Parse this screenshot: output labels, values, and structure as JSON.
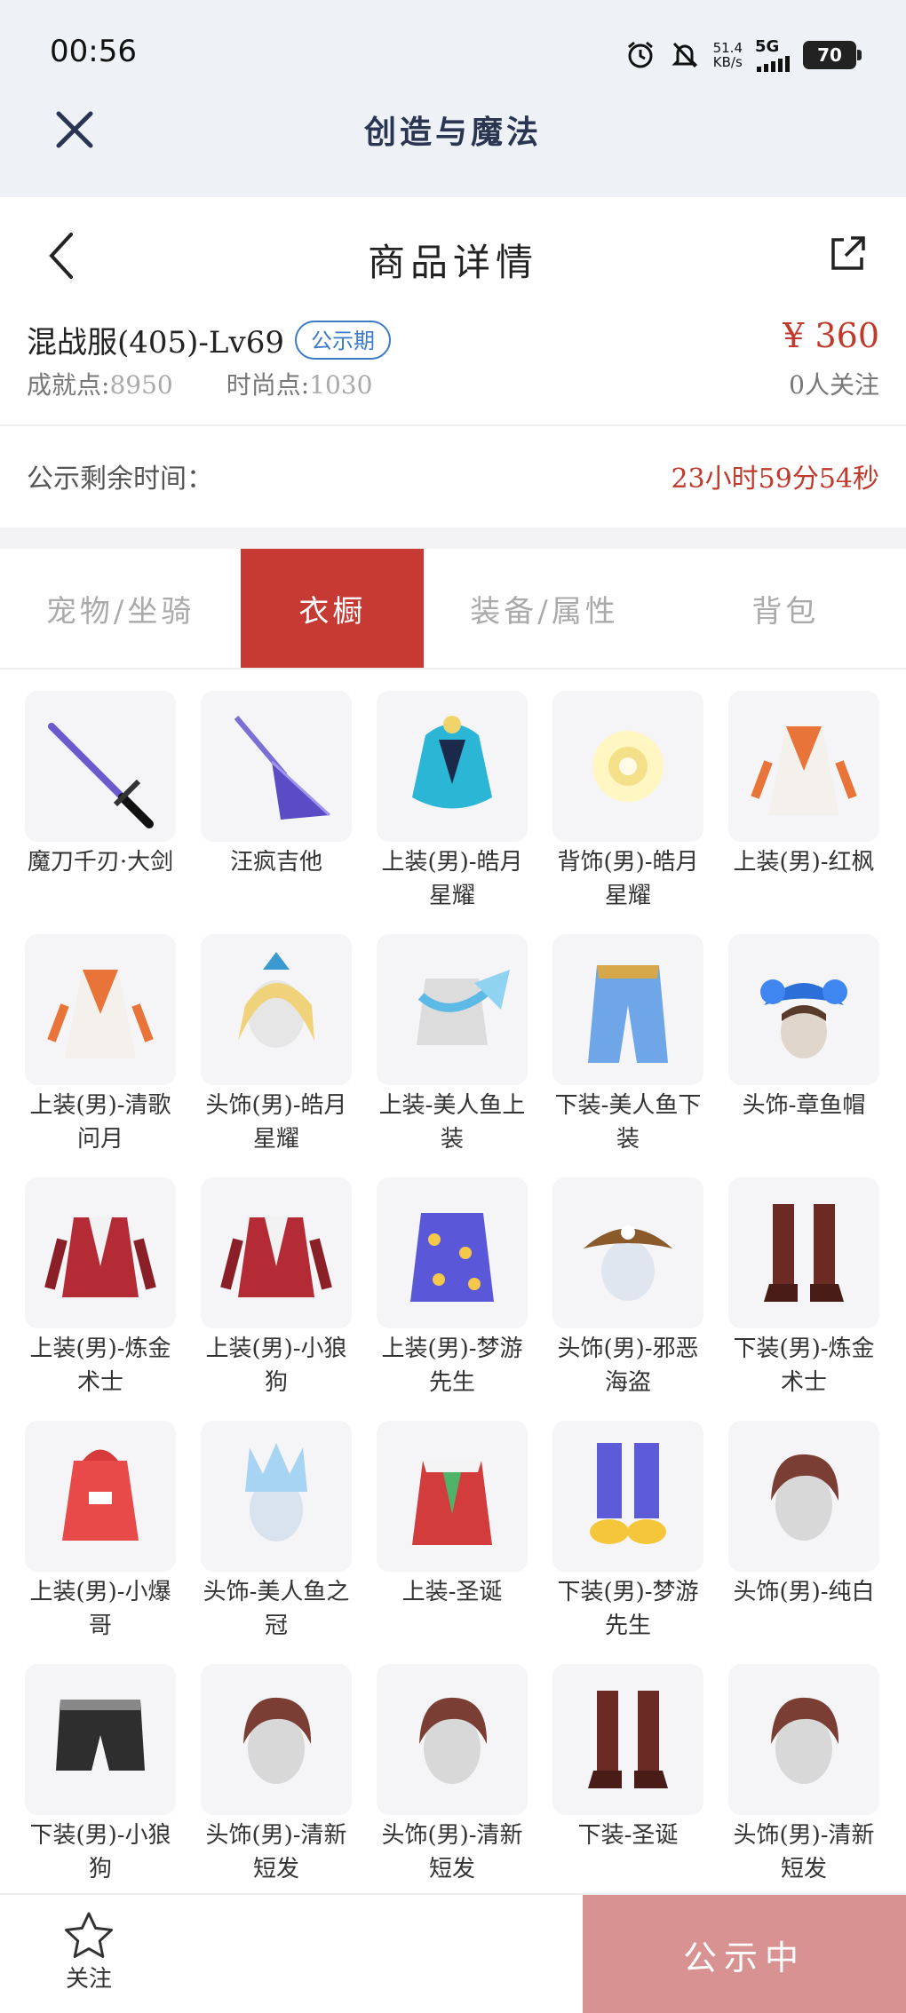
{
  "status": {
    "time": "00:56",
    "net_speed_top": "51.4",
    "net_speed_bottom": "KB/s",
    "network": "5G",
    "battery": "70"
  },
  "app": {
    "title": "创造与魔法"
  },
  "page": {
    "title": "商品详情"
  },
  "product": {
    "name": "混战服(405)-Lv69",
    "badge": "公示期",
    "price": "¥ 360",
    "achievement_label": "成就点:",
    "achievement_value": "8950",
    "fashion_label": "时尚点:",
    "fashion_value": "1030",
    "followers": "0人关注"
  },
  "countdown": {
    "label": "公示剩余时间：",
    "value": "23小时59分54秒"
  },
  "tabs": [
    {
      "label": "宠物/坐骑",
      "active": false
    },
    {
      "label": "衣橱",
      "active": true
    },
    {
      "label": "装备/属性",
      "active": false
    },
    {
      "label": "背包",
      "active": false
    }
  ],
  "items": [
    {
      "name": "魔刀千刃·大剑",
      "icon": "sword-icon"
    },
    {
      "name": "汪疯吉他",
      "icon": "guitar-icon"
    },
    {
      "name": "上装(男)-皓月星耀",
      "icon": "armor-icon"
    },
    {
      "name": "背饰(男)-皓月星耀",
      "icon": "orb-icon"
    },
    {
      "name": "上装(男)-红枫",
      "icon": "robe-icon"
    },
    {
      "name": "上装(男)-清歌问月",
      "icon": "robe-icon"
    },
    {
      "name": "头饰(男)-皓月星耀",
      "icon": "head-icon"
    },
    {
      "name": "上装-美人鱼上装",
      "icon": "shirt-icon"
    },
    {
      "name": "下装-美人鱼下装",
      "icon": "pants-icon"
    },
    {
      "name": "头饰-章鱼帽",
      "icon": "hat-icon"
    },
    {
      "name": "上装(男)-炼金术士",
      "icon": "jacket-icon"
    },
    {
      "name": "上装(男)-小狼狗",
      "icon": "jacket-icon"
    },
    {
      "name": "上装(男)-梦游先生",
      "icon": "pajama-icon"
    },
    {
      "name": "头饰(男)-邪恶海盗",
      "icon": "pirate-hat-icon"
    },
    {
      "name": "下装(男)-炼金术士",
      "icon": "boots-icon"
    },
    {
      "name": "上装(男)-小爆哥",
      "icon": "hoodie-icon"
    },
    {
      "name": "头饰-美人鱼之冠",
      "icon": "crown-icon"
    },
    {
      "name": "上装-圣诞",
      "icon": "coat-icon"
    },
    {
      "name": "下装(男)-梦游先生",
      "icon": "slippers-icon"
    },
    {
      "name": "头饰(男)-纯白",
      "icon": "hair-icon"
    },
    {
      "name": "下装(男)-小狼狗",
      "icon": "shorts-icon"
    },
    {
      "name": "头饰(男)-清新短发",
      "icon": "hair-icon"
    },
    {
      "name": "头饰(男)-清新短发",
      "icon": "hair-icon"
    },
    {
      "name": "下装-圣诞",
      "icon": "boots-icon"
    },
    {
      "name": "头饰(男)-清新短发",
      "icon": "hair-icon"
    }
  ],
  "bottom": {
    "follow_label": "关注",
    "status_button": "公示中"
  },
  "colors": {
    "accent": "#c73a34",
    "price": "#c0392b",
    "badge": "#3b7ac8",
    "status_button": "#d89292"
  }
}
